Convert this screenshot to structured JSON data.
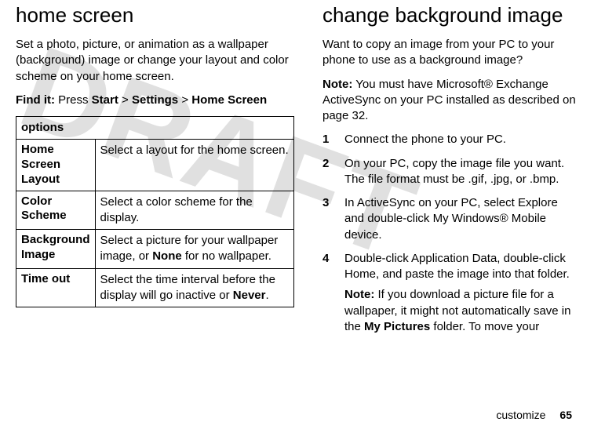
{
  "watermark": "DRAFT",
  "left": {
    "heading": "home screen",
    "intro": "Set a photo, picture, or animation as a wallpaper (background) image or change your layout and color scheme on your home screen.",
    "findit_label": "Find it:",
    "findit_prefix": "Press ",
    "findit_path_parts": [
      "Start",
      "Settings",
      "Home Screen"
    ],
    "findit_sep": " > ",
    "table_header": "options",
    "rows": [
      {
        "name": "Home Screen Layout",
        "desc": "Select a layout for the home screen."
      },
      {
        "name": "Color Scheme",
        "desc": "Select a color scheme for the display."
      },
      {
        "name": "Background Image",
        "desc_pre": "Select a picture for your wallpaper image, or ",
        "desc_bold": "None",
        "desc_post": " for no wallpaper."
      },
      {
        "name": "Time out",
        "desc_pre": "Select the time interval before the display will go inactive or ",
        "desc_bold": "Never",
        "desc_post": "."
      }
    ]
  },
  "right": {
    "heading": "change background image",
    "intro": "Want to copy an image from your PC to your phone to use as a background image?",
    "note_label": "Note:",
    "note_text": " You must have Microsoft® Exchange ActiveSync on your PC installed as described on page 32.",
    "steps": [
      {
        "num": "1",
        "text": "Connect the phone to your PC."
      },
      {
        "num": "2",
        "text": "On your PC, copy the image file you want. The file format must be .gif, .jpg, or .bmp."
      },
      {
        "num": "3",
        "pre": "In ActiveSync on your PC, select ",
        "mid1": "Explore",
        "mid2": " and double-click ",
        "mid3": "My Windows® Mobile device",
        "post": "."
      },
      {
        "num": "4",
        "pre": "Double-click ",
        "mid1": "Application Data",
        "mid2": ", double-click ",
        "mid3": "Home",
        "post": ", and paste the image into that folder.",
        "subnote_label": "Note:",
        "subnote_pre": " If you download a picture file for a wallpaper, it might not automatically save in the ",
        "subnote_bold": "My Pictures",
        "subnote_post": " folder. To move your"
      }
    ]
  },
  "footer": {
    "section": "customize",
    "page": "65"
  }
}
